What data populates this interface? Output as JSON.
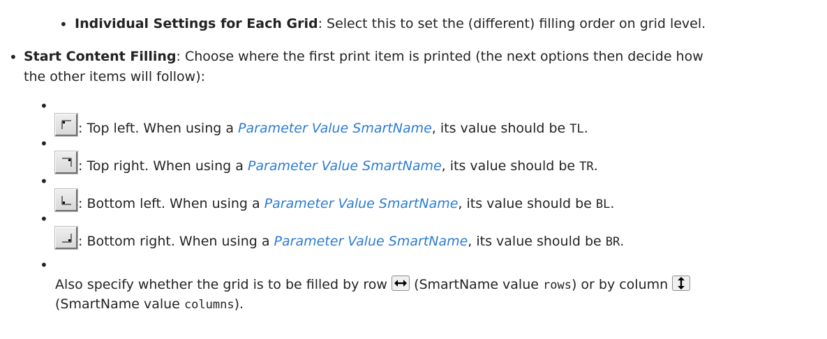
{
  "items": {
    "individual": {
      "term": "Individual Settings for Each Grid",
      "text": ": Select this to set the (different) filling order on grid level."
    },
    "start": {
      "term": "Start Content Filling",
      "text": ": Choose where the first print item is printed (the next options then decide how",
      "text2": "the other items will follow):"
    },
    "corners": [
      {
        "icon": "top-left-corner-icon",
        "desc": ": Top left. When using a ",
        "link": "Parameter Value SmartName",
        "mid": ", its value should be ",
        "value": "TL",
        "end": "."
      },
      {
        "icon": "top-right-corner-icon",
        "desc": ": Top right. When using a ",
        "link": "Parameter Value SmartName",
        "mid": ", its value should be ",
        "value": "TR",
        "end": "."
      },
      {
        "icon": "bottom-left-corner-icon",
        "desc": ": Bottom left. When using a ",
        "link": "Parameter Value SmartName",
        "mid": ", its value should be ",
        "value": "BL",
        "end": "."
      },
      {
        "icon": "bottom-right-corner-icon",
        "desc": ": Bottom right. When using a ",
        "link": "Parameter Value SmartName",
        "mid": ", its value should be ",
        "value": "BR",
        "end": "."
      }
    ],
    "direction": {
      "t1": "Also specify whether the grid is to be filled by row",
      "t2": "(SmartName value",
      "v1": "rows",
      "t3": ") or by column",
      "t4": "(SmartName value",
      "v2": "columns",
      "t5": ")."
    }
  }
}
